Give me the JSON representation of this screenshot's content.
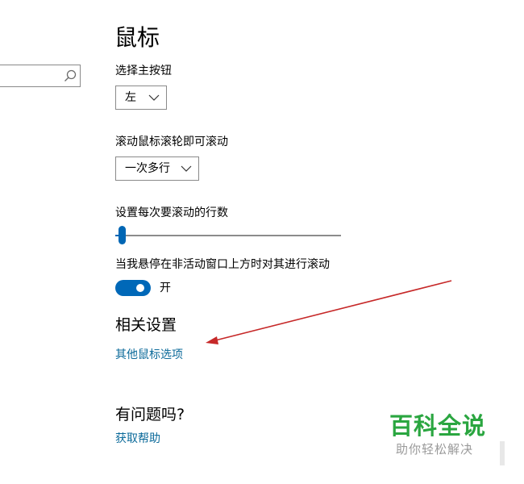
{
  "page": {
    "title": "鼠标"
  },
  "search": {
    "placeholder": ""
  },
  "primary_button": {
    "label": "选择主按钮",
    "value": "左"
  },
  "wheel_scroll": {
    "label": "滚动鼠标滚轮即可滚动",
    "value": "一次多行"
  },
  "lines_to_scroll": {
    "label": "设置每次要滚动的行数",
    "value_fraction": 0.02
  },
  "inactive_scroll": {
    "label": "当我悬停在非活动窗口上方时对其进行滚动",
    "toggle_state": "开",
    "on": true
  },
  "related": {
    "heading": "相关设置",
    "link": "其他鼠标选项"
  },
  "help": {
    "heading": "有问题吗?",
    "link": "获取帮助"
  },
  "watermark": {
    "title": "百科全说",
    "subtitle": "助你轻松解决"
  },
  "colors": {
    "accent": "#0068b8",
    "link": "#0b6a9a",
    "annotation_arrow": "#c62828",
    "watermark_green": "#2aa640"
  }
}
